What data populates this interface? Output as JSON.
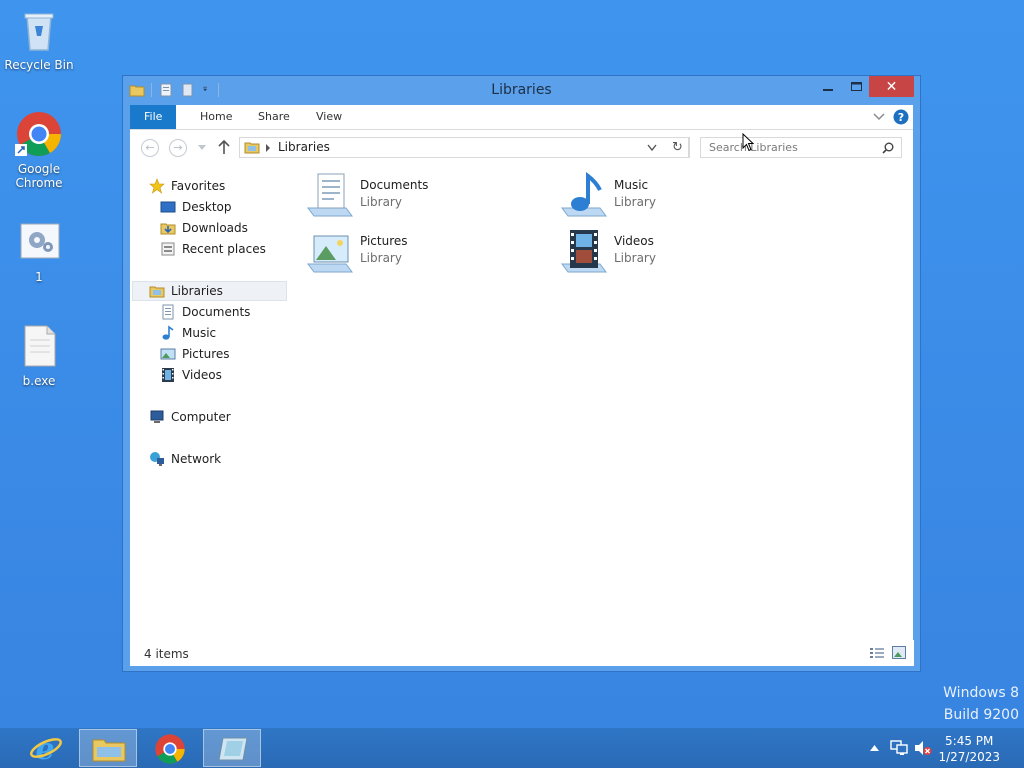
{
  "desktop": {
    "icons": [
      {
        "label": "Recycle Bin"
      },
      {
        "label": "Google\nChrome"
      },
      {
        "label": "1"
      },
      {
        "label": "b.exe"
      }
    ],
    "watermark_line1": "Windows 8",
    "watermark_line2": "Build 9200"
  },
  "window": {
    "title": "Libraries",
    "close_symbol": "✕",
    "tabs": [
      {
        "label": "File"
      },
      {
        "label": "Home"
      },
      {
        "label": "Share"
      },
      {
        "label": "View"
      }
    ],
    "address": {
      "path": "Libraries"
    },
    "search": {
      "placeholder": "Search Libraries"
    },
    "nav": {
      "favorites": "Favorites",
      "desktop": "Desktop",
      "downloads": "Downloads",
      "recent": "Recent places",
      "libraries": "Libraries",
      "documents": "Documents",
      "music": "Music",
      "pictures": "Pictures",
      "videos": "Videos",
      "computer": "Computer",
      "network": "Network"
    },
    "libraries": [
      {
        "name": "Documents",
        "type": "Library"
      },
      {
        "name": "Music",
        "type": "Library"
      },
      {
        "name": "Pictures",
        "type": "Library"
      },
      {
        "name": "Videos",
        "type": "Library"
      }
    ],
    "status": "4 items"
  },
  "taskbar": {
    "time": "5:45 PM",
    "date": "1/27/2023"
  },
  "colors": {
    "desktop": "#3a8ae6",
    "accent": "#1979ca",
    "close": "#c74545"
  }
}
